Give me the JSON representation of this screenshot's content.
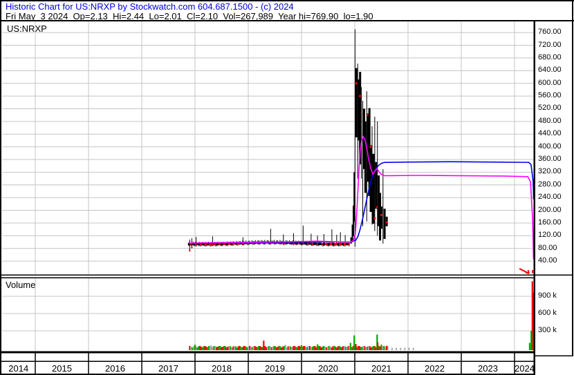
{
  "header": {
    "line1": "Historic Chart for US:NRXP by Stockwatch.com 604.687.1500 - (c) 2024",
    "line2": "Fri May  3 2024  Op=2.13  Hi=2.44  Lo=2.01  Cl=2.10  Vol=267,989  Year hi=769.90  lo=1.90"
  },
  "price_panel": {
    "symbol": "US:NRXP"
  },
  "volume_panel": {
    "label": "Volume"
  },
  "colors": {
    "header_text": "#0000dd",
    "grid": "#c4c4c4",
    "candle": "#000000",
    "mark": "#ff0000",
    "ma_fast": "#ff00ff",
    "ma_slow": "#0000ee",
    "vol_up": "#00a800",
    "vol_down": "#ff0000",
    "vol_neutral": "#aaaaaa",
    "border": "#000000"
  },
  "chart_data": {
    "type": "candlestick",
    "symbol": "US:NRXP",
    "date": "Fri May 3 2024",
    "quote": {
      "open": 2.13,
      "high": 2.44,
      "low": 2.01,
      "close": 2.1,
      "volume": 267989,
      "year_high": 769.9,
      "year_low": 1.9
    },
    "x_axis": {
      "years": [
        "2014",
        "2015",
        "2016",
        "2017",
        "2018",
        "2019",
        "2020",
        "2021",
        "2022",
        "2023",
        "2024"
      ],
      "start_t": 2014.37,
      "end_t": 2024.42,
      "year_boundaries": [
        2015,
        2016,
        2017,
        2018,
        2019,
        2020,
        2021,
        2022,
        2023,
        2024
      ]
    },
    "price_axis": {
      "ticks": [
        760,
        720,
        680,
        640,
        600,
        560,
        520,
        480,
        440,
        400,
        360,
        320,
        280,
        240,
        200,
        160,
        120,
        80,
        40
      ],
      "format": "0.00"
    },
    "volume_axis": {
      "tick_labels": [
        "900 k",
        "600 k",
        "300 k"
      ],
      "tick_values_k": [
        900,
        600,
        300
      ]
    },
    "flat_segment": {
      "t_start": 2017.88,
      "t_end": 2020.9,
      "step": 0.022,
      "typical_price": 96,
      "price_range": [
        88,
        112
      ]
    },
    "feature_wicks": [
      [
        2017.9,
        108,
        70
      ],
      [
        2017.94,
        112,
        80
      ],
      [
        2018.02,
        116,
        86
      ],
      [
        2018.33,
        118,
        88
      ],
      [
        2018.9,
        115,
        90
      ],
      [
        2019.42,
        142,
        92
      ],
      [
        2019.66,
        124,
        90
      ],
      [
        2019.85,
        128,
        90
      ],
      [
        2020.03,
        152,
        95
      ],
      [
        2020.18,
        126,
        94
      ],
      [
        2020.3,
        120,
        97
      ],
      [
        2020.42,
        125,
        96
      ],
      [
        2020.57,
        140,
        96
      ],
      [
        2020.66,
        123,
        94
      ],
      [
        2020.73,
        131,
        95
      ],
      [
        2020.82,
        122,
        92
      ]
    ],
    "spike_candles": [
      [
        2020.93,
        115,
        95,
        2,
        null
      ],
      [
        2020.955,
        155,
        100,
        2,
        null
      ],
      [
        2020.975,
        215,
        118,
        2,
        null
      ],
      [
        2020.99,
        320,
        165,
        2,
        null
      ],
      [
        2021.005,
        770,
        85,
        1,
        null
      ],
      [
        2021.03,
        648,
        430,
        3,
        600
      ],
      [
        2021.055,
        662,
        300,
        1,
        null
      ],
      [
        2021.075,
        612,
        420,
        3,
        null
      ],
      [
        2021.1,
        636,
        345,
        3,
        560
      ],
      [
        2021.125,
        588,
        300,
        1,
        null
      ],
      [
        2021.15,
        545,
        150,
        1,
        null
      ],
      [
        2021.175,
        520,
        330,
        3,
        null
      ],
      [
        2021.2,
        480,
        255,
        3,
        null
      ],
      [
        2021.225,
        575,
        165,
        1,
        null
      ],
      [
        2021.25,
        505,
        290,
        3,
        500
      ],
      [
        2021.275,
        522,
        245,
        3,
        null
      ],
      [
        2021.3,
        405,
        195,
        3,
        400
      ],
      [
        2021.325,
        465,
        155,
        1,
        null
      ],
      [
        2021.35,
        378,
        158,
        3,
        null
      ],
      [
        2021.375,
        495,
        135,
        1,
        175
      ],
      [
        2021.4,
        352,
        205,
        3,
        null
      ],
      [
        2021.425,
        480,
        120,
        1,
        210
      ],
      [
        2021.45,
        310,
        150,
        3,
        null
      ],
      [
        2021.475,
        255,
        105,
        3,
        null
      ],
      [
        2021.5,
        212,
        142,
        3,
        185
      ],
      [
        2021.53,
        330,
        95,
        1,
        null
      ],
      [
        2021.56,
        205,
        110,
        3,
        null
      ],
      [
        2021.6,
        180,
        150,
        3,
        162
      ]
    ],
    "final_candle": {
      "t": 2024.34,
      "high": 12,
      "low": 2
    },
    "last_price_marker": {
      "t": 2024.34,
      "price": 2.1
    },
    "ma_fast_points": [
      [
        2017.88,
        97
      ],
      [
        2018.3,
        98
      ],
      [
        2018.8,
        99
      ],
      [
        2019.3,
        100
      ],
      [
        2019.8,
        101
      ],
      [
        2020.3,
        103
      ],
      [
        2020.6,
        101
      ],
      [
        2020.9,
        100
      ],
      [
        2020.97,
        104
      ],
      [
        2021.01,
        125
      ],
      [
        2021.04,
        200
      ],
      [
        2021.07,
        300
      ],
      [
        2021.1,
        385
      ],
      [
        2021.13,
        420
      ],
      [
        2021.16,
        432
      ],
      [
        2021.19,
        424
      ],
      [
        2021.22,
        400
      ],
      [
        2021.26,
        362
      ],
      [
        2021.3,
        332
      ],
      [
        2021.34,
        314
      ],
      [
        2021.38,
        324
      ],
      [
        2021.42,
        331
      ],
      [
        2021.46,
        320
      ],
      [
        2021.5,
        313
      ],
      [
        2021.56,
        309
      ],
      [
        2022.2,
        310
      ],
      [
        2023.0,
        309
      ],
      [
        2023.8,
        308
      ],
      [
        2024.25,
        306
      ],
      [
        2024.3,
        290
      ],
      [
        2024.34,
        170
      ],
      [
        2024.38,
        46
      ]
    ],
    "ma_slow_points": [
      [
        2017.95,
        95
      ],
      [
        2018.5,
        97
      ],
      [
        2019.0,
        98
      ],
      [
        2019.5,
        99
      ],
      [
        2020.0,
        100
      ],
      [
        2020.5,
        101
      ],
      [
        2020.93,
        100
      ],
      [
        2021.02,
        106
      ],
      [
        2021.06,
        118
      ],
      [
        2021.1,
        140
      ],
      [
        2021.15,
        175
      ],
      [
        2021.2,
        215
      ],
      [
        2021.25,
        255
      ],
      [
        2021.3,
        290
      ],
      [
        2021.35,
        316
      ],
      [
        2021.4,
        332
      ],
      [
        2021.45,
        342
      ],
      [
        2021.5,
        348
      ],
      [
        2021.56,
        351
      ],
      [
        2022.0,
        352
      ],
      [
        2022.8,
        353
      ],
      [
        2023.6,
        352
      ],
      [
        2024.27,
        351
      ],
      [
        2024.31,
        344
      ],
      [
        2024.35,
        290
      ],
      [
        2024.38,
        235
      ]
    ],
    "volume_features_k": [
      [
        2018.0,
        60,
        "up"
      ],
      [
        2018.3,
        45,
        "neutral"
      ],
      [
        2019.29,
        130,
        "down"
      ],
      [
        2019.7,
        55,
        "neutral"
      ],
      [
        2020.0,
        50,
        "up"
      ],
      [
        2020.3,
        65,
        "up"
      ],
      [
        2020.92,
        90,
        "up"
      ],
      [
        2020.99,
        220,
        "up"
      ],
      [
        2021.02,
        70,
        "down"
      ],
      [
        2021.42,
        235,
        "up"
      ],
      [
        2021.43,
        100,
        "down"
      ],
      [
        2021.5,
        60,
        "up"
      ],
      [
        2021.6,
        40,
        "down"
      ],
      [
        2024.285,
        90,
        "up"
      ],
      [
        2024.315,
        300,
        "up"
      ],
      [
        2024.335,
        1160,
        "down"
      ],
      [
        2024.36,
        290,
        "up"
      ],
      [
        2024.385,
        960,
        "down"
      ],
      [
        2024.41,
        300,
        "up"
      ],
      [
        2024.43,
        260,
        "up"
      ]
    ],
    "volume_background": {
      "t_start": 2017.9,
      "t_end": 2021.64,
      "step": 0.024,
      "max_k": 38
    },
    "volume_sparse": {
      "t_start": 2021.7,
      "t_end": 2022.1,
      "step": 0.08,
      "height_k": 6
    }
  }
}
